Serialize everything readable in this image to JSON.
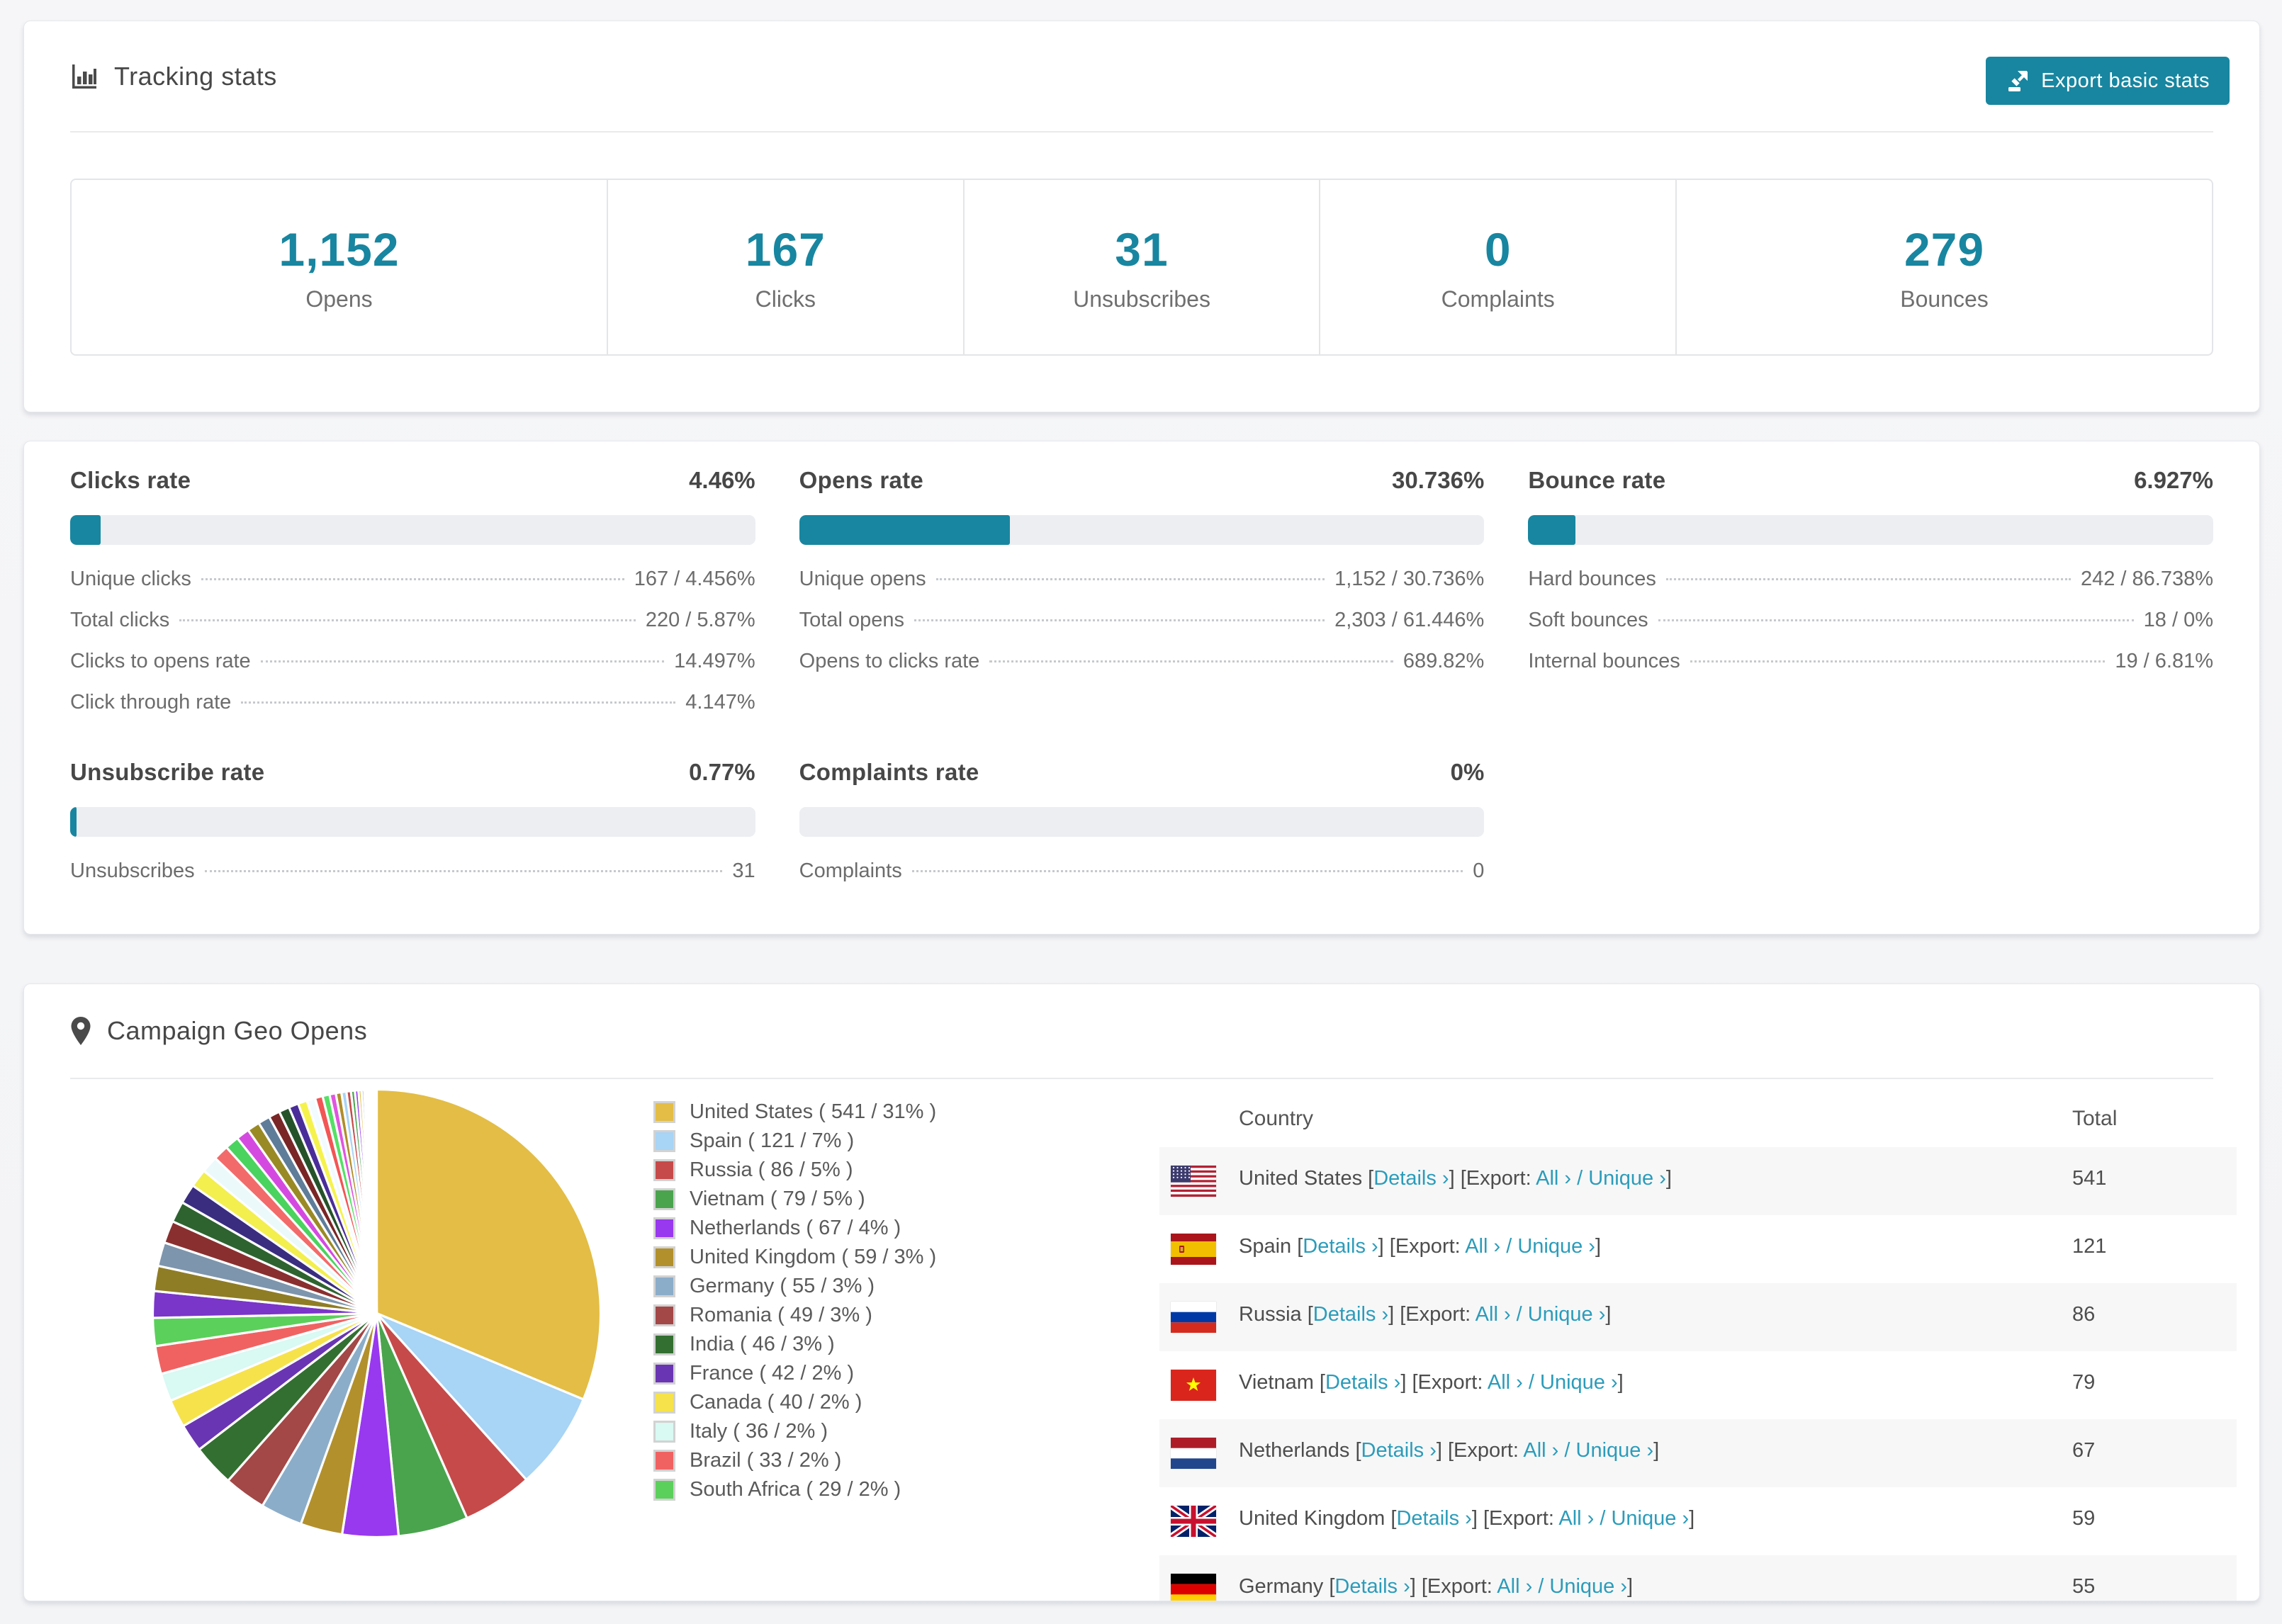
{
  "colors": {
    "accent": "#1886a0",
    "link": "#2b9cba",
    "bar_track": "#eceef1"
  },
  "tracking": {
    "title": "Tracking stats",
    "export_button": "Export basic stats",
    "stats": [
      {
        "value": "1,152",
        "label": "Opens"
      },
      {
        "value": "167",
        "label": "Clicks"
      },
      {
        "value": "31",
        "label": "Unsubscribes"
      },
      {
        "value": "0",
        "label": "Complaints"
      },
      {
        "value": "279",
        "label": "Bounces"
      }
    ]
  },
  "rates": {
    "blocks": [
      {
        "title": "Clicks rate",
        "percent": "4.46%",
        "bar_pct": 4.46,
        "rows": [
          {
            "label": "Unique clicks",
            "value": "167 / 4.456%"
          },
          {
            "label": "Total clicks",
            "value": "220 / 5.87%"
          },
          {
            "label": "Clicks to opens rate",
            "value": "14.497%"
          },
          {
            "label": "Click through rate",
            "value": "4.147%"
          }
        ]
      },
      {
        "title": "Opens rate",
        "percent": "30.736%",
        "bar_pct": 30.736,
        "rows": [
          {
            "label": "Unique opens",
            "value": "1,152 / 30.736%"
          },
          {
            "label": "Total opens",
            "value": "2,303 / 61.446%"
          },
          {
            "label": "Opens to clicks rate",
            "value": "689.82%"
          }
        ]
      },
      {
        "title": "Bounce rate",
        "percent": "6.927%",
        "bar_pct": 6.927,
        "rows": [
          {
            "label": "Hard bounces",
            "value": "242 / 86.738%"
          },
          {
            "label": "Soft bounces",
            "value": "18 / 0%"
          },
          {
            "label": "Internal bounces",
            "value": "19 / 6.81%"
          }
        ]
      },
      {
        "title": "Unsubscribe rate",
        "percent": "0.77%",
        "bar_pct": 0.77,
        "rows": [
          {
            "label": "Unsubscribes",
            "value": "31"
          }
        ]
      },
      {
        "title": "Complaints rate",
        "percent": "0%",
        "bar_pct": 0,
        "rows": [
          {
            "label": "Complaints",
            "value": "0"
          }
        ]
      }
    ]
  },
  "geo": {
    "title": "Campaign Geo Opens",
    "table": {
      "headers": {
        "country": "Country",
        "total": "Total"
      },
      "link_labels": {
        "details": "Details ›",
        "export": "Export:",
        "all": "All ›",
        "unique": "Unique ›"
      },
      "rows": [
        {
          "flag": "us",
          "country": "United States",
          "total": "541"
        },
        {
          "flag": "es",
          "country": "Spain",
          "total": "121"
        },
        {
          "flag": "ru",
          "country": "Russia",
          "total": "86"
        },
        {
          "flag": "vn",
          "country": "Vietnam",
          "total": "79"
        },
        {
          "flag": "nl",
          "country": "Netherlands",
          "total": "67"
        },
        {
          "flag": "gb",
          "country": "United Kingdom",
          "total": "59"
        },
        {
          "flag": "de",
          "country": "Germany",
          "total": "55",
          "partial": true
        }
      ]
    }
  },
  "chart_data": {
    "type": "pie",
    "title": "Campaign Geo Opens",
    "legend_position": "right",
    "start_angle_deg": -90,
    "direction": "clockwise",
    "slices": [
      {
        "name": "United States",
        "count": 541,
        "pct": 31,
        "color": "#e3bd45",
        "legend_label": "United States ( 541 / 31% )"
      },
      {
        "name": "Spain",
        "count": 121,
        "pct": 7,
        "color": "#a8d4f5",
        "legend_label": "Spain ( 121 / 7% )"
      },
      {
        "name": "Russia",
        "count": 86,
        "pct": 5,
        "color": "#c64a4a",
        "legend_label": "Russia ( 86 / 5% )"
      },
      {
        "name": "Vietnam",
        "count": 79,
        "pct": 5,
        "color": "#4aa44d",
        "legend_label": "Vietnam ( 79 / 5% )"
      },
      {
        "name": "Netherlands",
        "count": 67,
        "pct": 4,
        "color": "#9838ef",
        "legend_label": "Netherlands ( 67 / 4% )"
      },
      {
        "name": "United Kingdom",
        "count": 59,
        "pct": 3,
        "color": "#b2902c",
        "legend_label": "United Kingdom ( 59 / 3% )"
      },
      {
        "name": "Germany",
        "count": 55,
        "pct": 3,
        "color": "#8badc9",
        "legend_label": "Germany ( 55 / 3% )"
      },
      {
        "name": "Romania",
        "count": 49,
        "pct": 3,
        "color": "#a34747",
        "legend_label": "Romania ( 49 / 3% )"
      },
      {
        "name": "India",
        "count": 46,
        "pct": 3,
        "color": "#336f31",
        "legend_label": "India ( 46 / 3% )"
      },
      {
        "name": "France",
        "count": 42,
        "pct": 2,
        "color": "#6a35b2",
        "legend_label": "France ( 42 / 2% )"
      },
      {
        "name": "Canada",
        "count": 40,
        "pct": 2,
        "color": "#f6e24b",
        "legend_label": "Canada ( 40 / 2% )"
      },
      {
        "name": "Italy",
        "count": 36,
        "pct": 2,
        "color": "#d9f9f3",
        "legend_label": "Italy ( 36 / 2% )"
      },
      {
        "name": "Brazil",
        "count": 33,
        "pct": 2,
        "color": "#f06262",
        "legend_label": "Brazil ( 33 / 2% )"
      },
      {
        "name": "South Africa",
        "count": 29,
        "pct": 2,
        "color": "#5bd05b",
        "legend_label": "South Africa ( 29 / 2% )"
      }
    ],
    "others": {
      "note": "remaining small countries rendered as unlabeled thin slices",
      "values": [
        1.9,
        1.8,
        1.7,
        1.6,
        1.5,
        1.4,
        1.3,
        1.2,
        1.1,
        1.0,
        0.95,
        0.9,
        0.85,
        0.8,
        0.75,
        0.7,
        0.65,
        0.6,
        0.55,
        0.5,
        0.45,
        0.4,
        0.36,
        0.32,
        0.28,
        0.25,
        0.22,
        0.19,
        0.16,
        0.14,
        0.12,
        0.1,
        0.08,
        0.07,
        0.06,
        0.05,
        0.04,
        0.03,
        0.02,
        0.01
      ],
      "colors": [
        "#7a35c9",
        "#8f7d26",
        "#7d95ad",
        "#8a2f2f",
        "#2e6330",
        "#3a2d80",
        "#f2ef4e",
        "#ebf9fb",
        "#f26a6a",
        "#4ad35e",
        "#d44ae0",
        "#9a8a26",
        "#5f7d99",
        "#7a2626",
        "#26522a",
        "#4a2d99",
        "#f5f24e",
        "#f2fbff",
        "#f25555",
        "#55e065",
        "#e055e0",
        "#b08c2a",
        "#a8d4f5",
        "#c64a4a",
        "#4aa44d",
        "#9838ef",
        "#e3bd45",
        "#8badc9",
        "#a34747",
        "#336f31",
        "#6a35b2",
        "#f6e24b",
        "#d9f9f3",
        "#f06262",
        "#5bd05b",
        "#7a35c9",
        "#8f7d26",
        "#7d95ad",
        "#8a2f2f",
        "#2e6330"
      ]
    }
  }
}
